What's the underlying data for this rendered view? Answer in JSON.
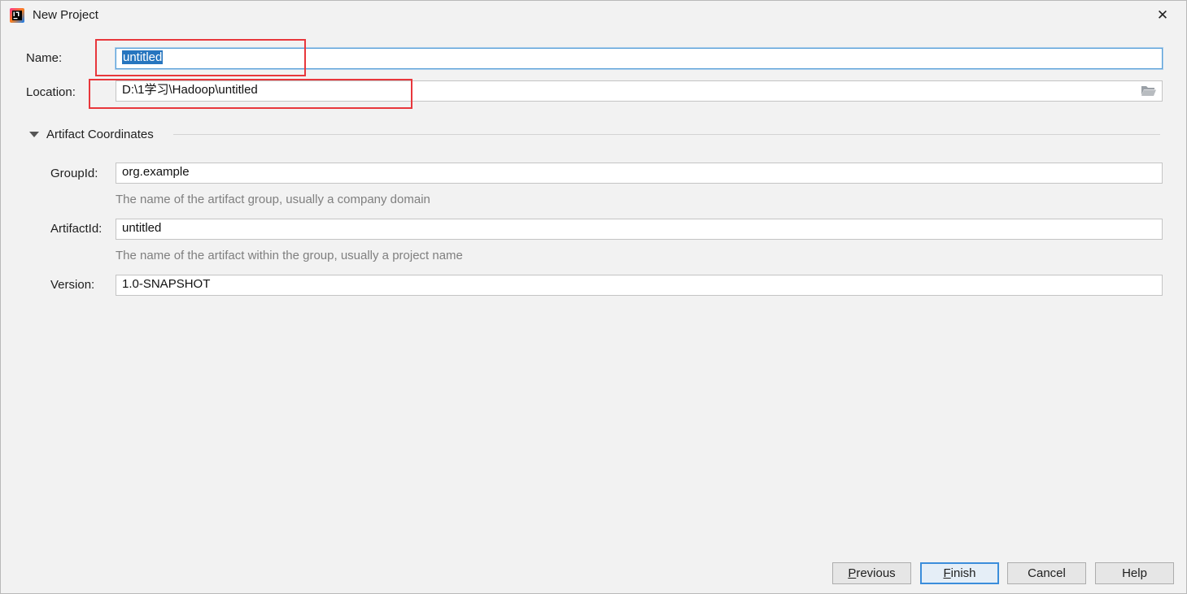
{
  "window": {
    "title": "New Project",
    "close_symbol": "✕"
  },
  "form": {
    "name": {
      "label": "Name:",
      "value": "untitled"
    },
    "location": {
      "label": "Location:",
      "value": "D:\\1学习\\Hadoop\\untitled"
    }
  },
  "artifact": {
    "section_title": "Artifact Coordinates",
    "group_id": {
      "label": "GroupId:",
      "value": "org.example",
      "hint": "The name of the artifact group, usually a company domain"
    },
    "artifact_id": {
      "label": "ArtifactId:",
      "value": "untitled",
      "hint": "The name of the artifact within the group, usually a project name"
    },
    "version": {
      "label": "Version:",
      "value": "1.0-SNAPSHOT"
    }
  },
  "buttons": {
    "previous": {
      "mnemonic": "P",
      "rest": "revious"
    },
    "finish": {
      "mnemonic": "F",
      "rest": "inish"
    },
    "cancel": {
      "label": "Cancel"
    },
    "help": {
      "label": "Help"
    }
  },
  "icons": {
    "app": "intellij-idea-icon",
    "close": "close-icon",
    "folder": "folder-open-icon",
    "collapse": "triangle-down-icon"
  },
  "colors": {
    "background": "#f2f2f2",
    "selection": "#2675bf",
    "focus_border": "#5aa0d8",
    "annotation": "#e8373c",
    "hint_text": "#7f7f7f"
  }
}
